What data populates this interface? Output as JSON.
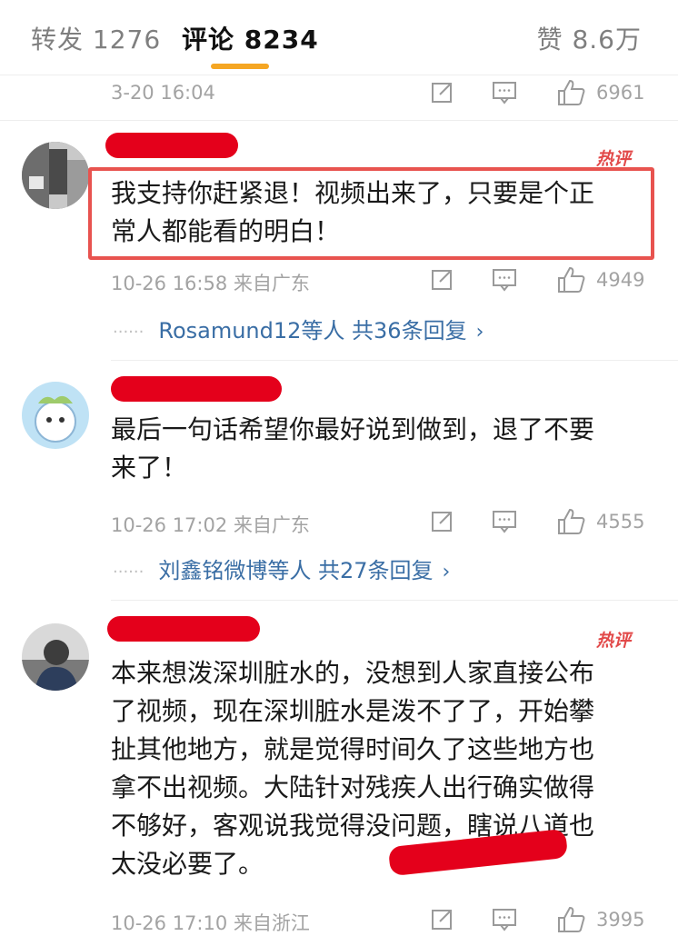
{
  "tabs": {
    "repost": "转发 1276",
    "comments": "评论 8234",
    "likes": "赞 8.6万"
  },
  "prev_comment": {
    "time": "3-20 16:04",
    "likes": "6961"
  },
  "comments": [
    {
      "badge": "热评",
      "text": "我支持你赶紧退！视频出来了，只要是个正\n常人都能看的明白！",
      "meta": "10-26 16:58 来自广东",
      "likes": "4949",
      "replies": "Rosamund12等人 共36条回复"
    },
    {
      "badge": "",
      "text": "最后一句话希望你最好说到做到，退了不要\n来了！",
      "meta": "10-26 17:02 来自广东",
      "likes": "4555",
      "replies": "刘鑫铭微博等人 共27条回复"
    },
    {
      "badge": "热评",
      "text": "本来想泼深圳脏水的，没想到人家直接公布\n了视频，现在深圳脏水是泼不了了，开始攀\n扯其他地方，就是觉得时间久了这些地方也\n拿不出视频。大陆针对残疾人出行确实做得\n不够好，客观说我觉得没问题，瞎说八道也\n太没必要了。",
      "meta": "10-26 17:10 来自浙江",
      "likes": "3995",
      "replies": ""
    }
  ],
  "colors": {
    "accent_underline": "#f5a623",
    "redaction": "#e4001b",
    "highlight_box": "#e8534f",
    "reply_link": "#3a6ea5",
    "hot_badge": "#e24a4a"
  },
  "icons": [
    "share-icon",
    "reply-icon",
    "thumbs-up-icon",
    "chevron-right-icon"
  ]
}
